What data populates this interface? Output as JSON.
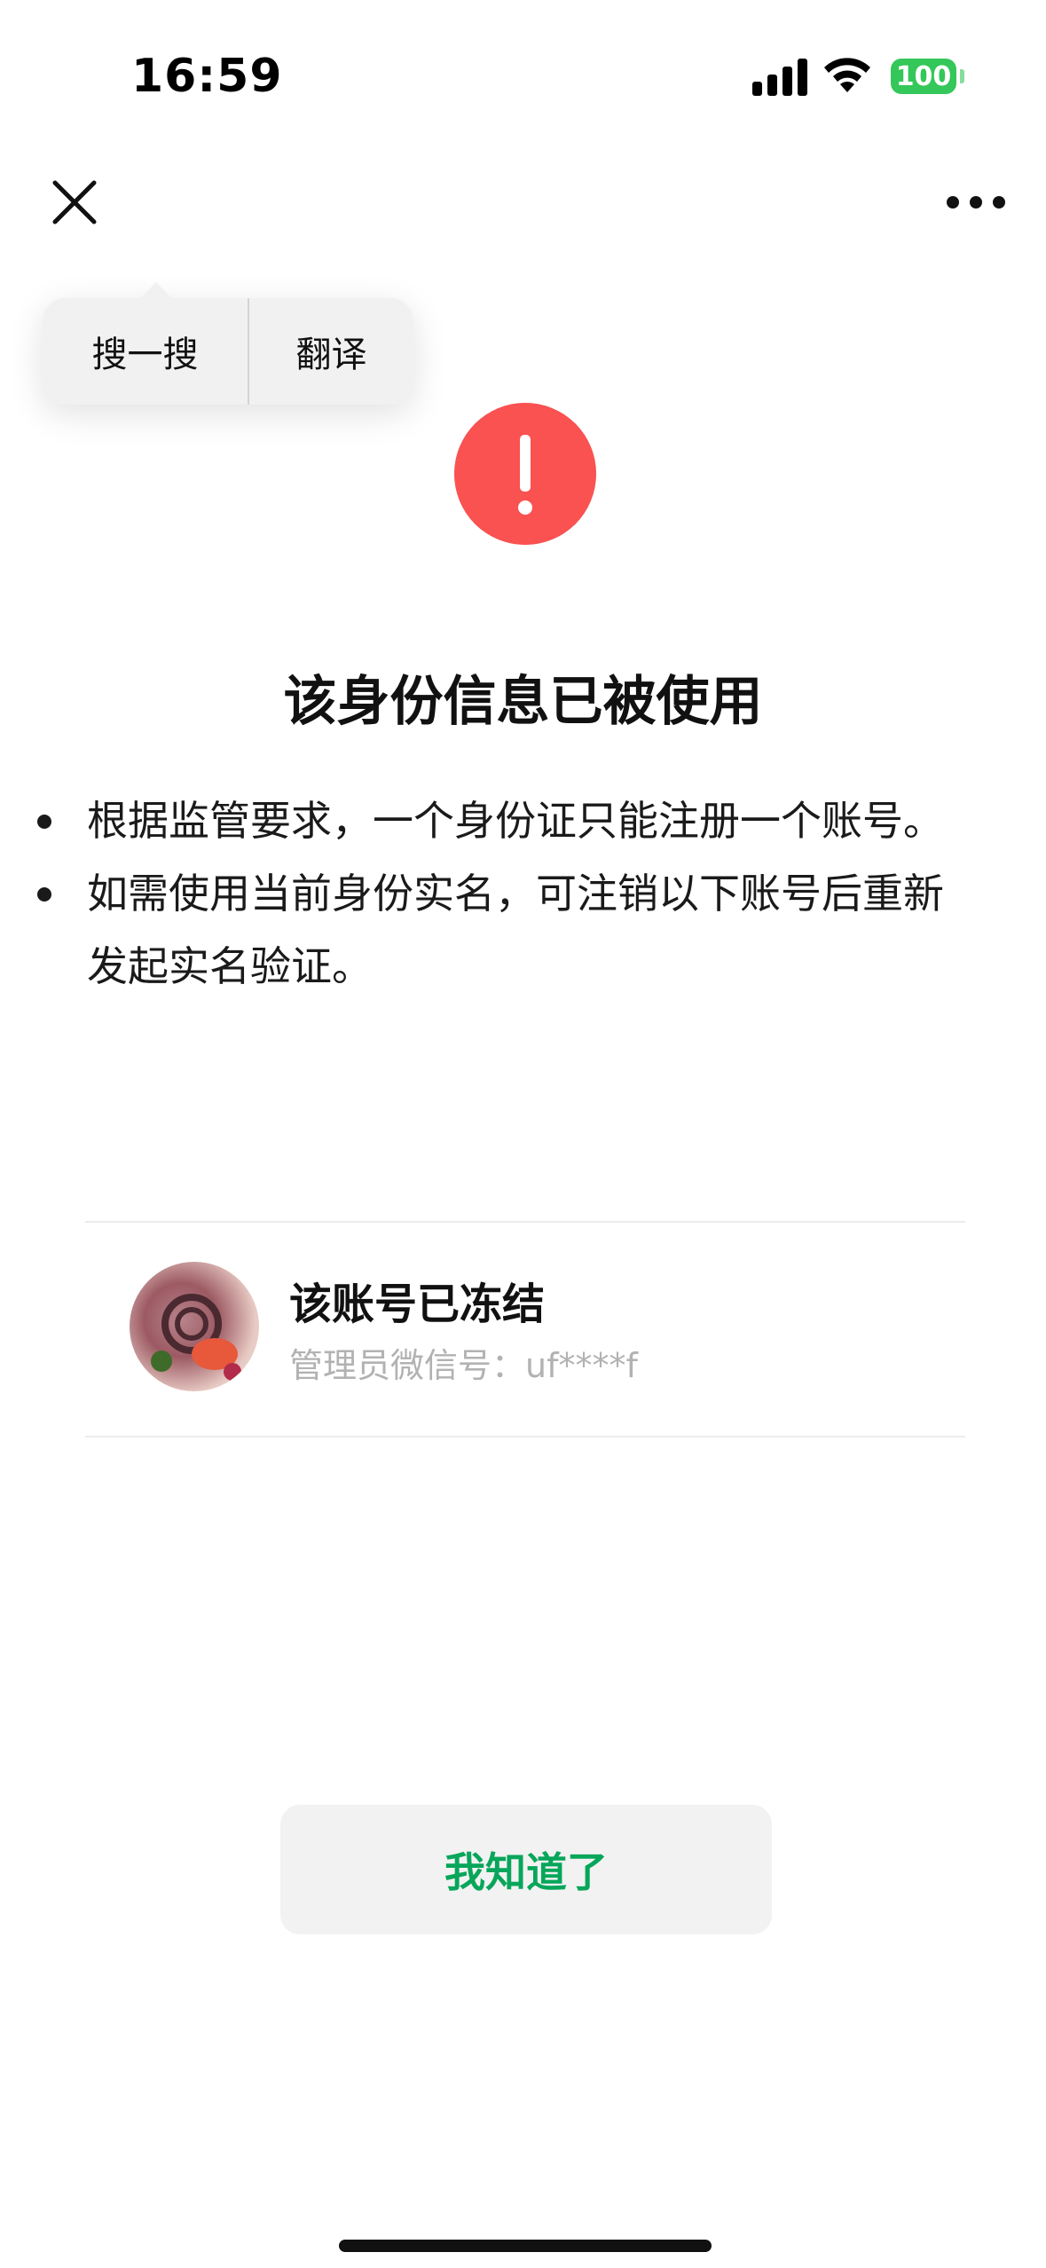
{
  "status_bar": {
    "time": "16:59",
    "battery": "100",
    "icons": [
      "cellular-signal-icon",
      "wifi-icon",
      "battery-icon"
    ],
    "battery_color": "#34c759"
  },
  "top_bar": {
    "icons": [
      "close-icon",
      "more-icon"
    ]
  },
  "popup_menu": {
    "items": [
      {
        "label": "搜一搜"
      },
      {
        "label": "翻译"
      }
    ]
  },
  "alert": {
    "icon": "exclamation-icon",
    "icon_color": "#fa5151",
    "title": "该身份信息已被使用",
    "bullets": [
      "根据监管要求，一个身份证只能注册一个账号。",
      "如需使用当前身份实名，可注销以下账号后重新发起实名验证。"
    ]
  },
  "account": {
    "name": "该账号已冻结",
    "subtitle": "管理员微信号：uf****f"
  },
  "actions": {
    "confirm_label": "我知道了",
    "confirm_color": "#07a65a"
  }
}
